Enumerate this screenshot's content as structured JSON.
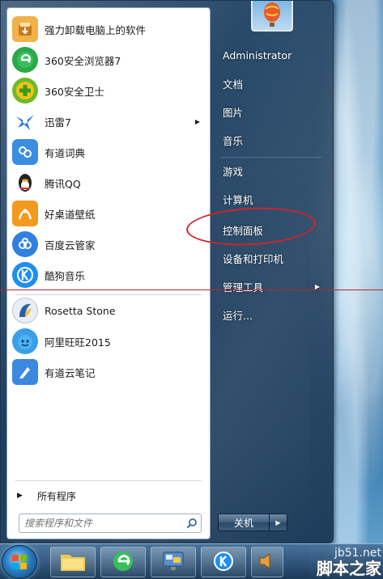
{
  "programs": [
    {
      "label": "强力卸载电脑上的软件",
      "icon": "uninstaller-icon",
      "color": "#e8a23a"
    },
    {
      "label": "360安全浏览器7",
      "icon": "360-browser-icon",
      "color": "#2aa84a"
    },
    {
      "label": "360安全卫士",
      "icon": "360-safe-guard-icon",
      "color": "#5bb52b"
    },
    {
      "label": "迅雷7",
      "icon": "thunder-icon",
      "color": "#2b7fd6",
      "has_submenu": true
    },
    {
      "label": "有道词典",
      "icon": "youdao-dict-icon",
      "color": "#3a8de0"
    },
    {
      "label": "腾讯QQ",
      "icon": "qq-penguin-icon",
      "color": "#222222"
    },
    {
      "label": "好桌道壁纸",
      "icon": "wallpaper-icon",
      "color": "#f39a1e"
    },
    {
      "label": "百度云管家",
      "icon": "baidu-cloud-icon",
      "color": "#2f80e0"
    },
    {
      "label": "酷狗音乐",
      "icon": "kugou-music-icon",
      "color": "#1f8ff0"
    },
    {
      "label": "Rosetta Stone",
      "icon": "rosetta-stone-icon",
      "color": "#2a5fa8"
    },
    {
      "label": "阿里旺旺2015",
      "icon": "aliwangwang-icon",
      "color": "#3a9ee8"
    },
    {
      "label": "有道云笔记",
      "icon": "youdao-note-icon",
      "color": "#3c88e0"
    }
  ],
  "all_programs": "所有程序",
  "search": {
    "placeholder": "搜索程序和文件"
  },
  "right_items": [
    {
      "label": "Administrator"
    },
    {
      "label": "文档"
    },
    {
      "label": "图片"
    },
    {
      "label": "音乐"
    },
    {
      "label": "游戏"
    },
    {
      "label": "计算机"
    },
    {
      "label": "控制面板"
    },
    {
      "label": "设备和打印机"
    },
    {
      "label": "管理工具",
      "has_submenu": true
    },
    {
      "label": "运行..."
    }
  ],
  "shutdown": {
    "label": "关机"
  },
  "watermark": {
    "line1": "jb51.net",
    "line2": "脚本之家"
  }
}
